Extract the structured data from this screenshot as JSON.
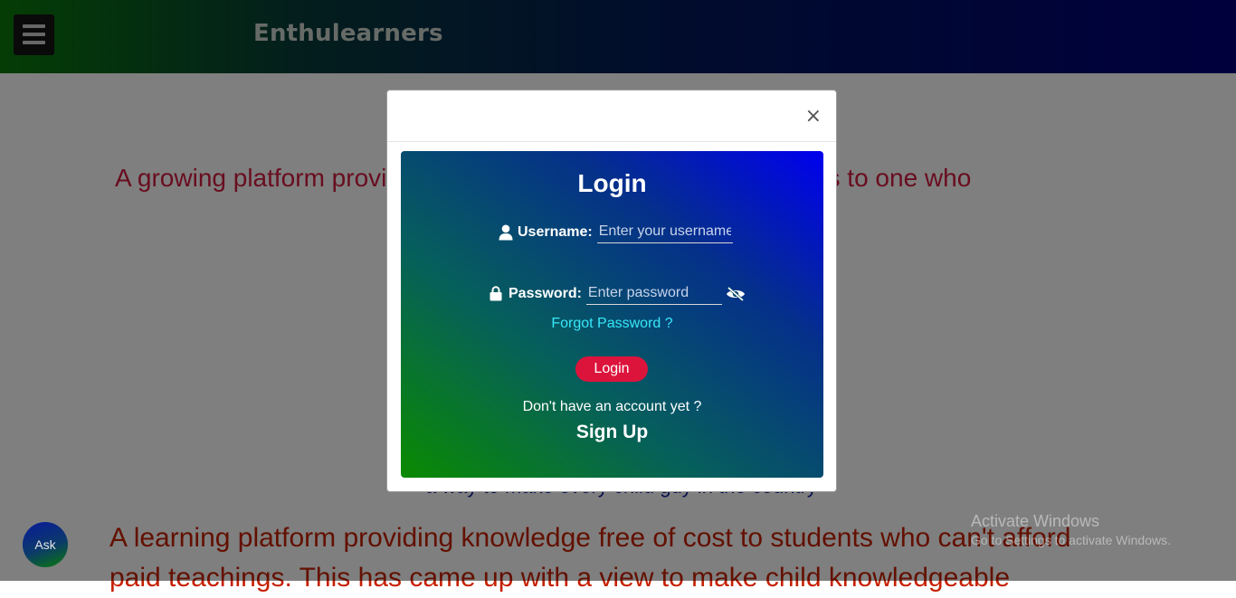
{
  "header": {
    "brand": "Enthulearners",
    "menu_icon": "hamburger-menu-icon"
  },
  "content": {
    "tagline1": "A growing platform providing solutions from basic level questions to one who",
    "hidden_line": "a way to make every child guy in the country",
    "tagline2": "A learning platform providing knowledge free of cost to students who can't afford paid teachings. This has came up with a view to make child knowledgeable",
    "ask_label": "Ask"
  },
  "modal": {
    "close_label": "×",
    "title": "Login",
    "username_label": "Username:",
    "username_placeholder": "Enter your username",
    "username_icon": "user-icon",
    "password_label": "Password:",
    "password_placeholder": "Enter password",
    "password_icon": "lock-icon",
    "toggle_icon": "eye-slash-icon",
    "forgot_label": "Forgot Password ?",
    "login_button": "Login",
    "no_account_text": "Don't have an account yet ?",
    "signup_label": "Sign Up"
  },
  "watermark": {
    "line1": "Activate Windows",
    "line2": "Go to Settings to activate Windows."
  },
  "colors": {
    "accent_red": "#dc143c",
    "link_cyan": "#37e8f8",
    "header_blue": "#00007a",
    "header_green": "#0a7a0a"
  }
}
